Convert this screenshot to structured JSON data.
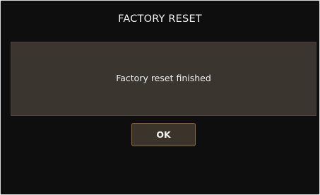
{
  "dialog": {
    "title": "FACTORY RESET",
    "message": "Factory reset finished",
    "ok_label": "OK"
  },
  "colors": {
    "background": "#0e0e0f",
    "panel": "#3a352e",
    "button_border": "#8a6b3b",
    "text": "#f0f0f0"
  }
}
